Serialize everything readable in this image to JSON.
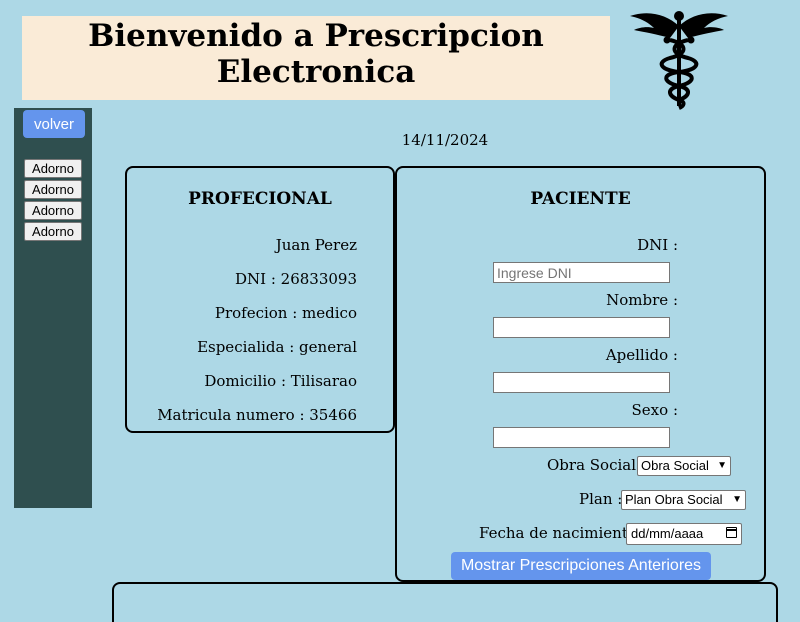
{
  "header": {
    "title_line1": "Bienvenido a Prescripcion",
    "title_line2": "Electronica",
    "logo_icon": "caduceus-icon"
  },
  "sidebar": {
    "back_label": "volver",
    "adornos": [
      "Adorno",
      "Adorno",
      "Adorno",
      "Adorno"
    ]
  },
  "date": "14/11/2024",
  "profesional": {
    "title": "PROFECIONAL",
    "name": "Juan Perez",
    "dni": "DNI : 26833093",
    "profesion": "Profecion : medico",
    "especialidad": "Especialida : general",
    "domicilio": "Domicilio : Tilisarao",
    "matricula": "Matricula numero : 35466"
  },
  "paciente": {
    "title": "PACIENTE",
    "dni_label": "DNI :",
    "dni_placeholder": "Ingrese DNI",
    "nombre_label": "Nombre :",
    "apellido_label": "Apellido :",
    "sexo_label": "Sexo :",
    "obra_social_label": "Obra Social :",
    "obra_social_selected": "Obra Social",
    "plan_label": "Plan :",
    "plan_selected": "Plan Obra Social",
    "fecha_label": "Fecha de nacimiento :",
    "fecha_placeholder": "dd/mm/aaaa",
    "mostrar_button": "Mostrar Prescripciones Anteriores"
  }
}
